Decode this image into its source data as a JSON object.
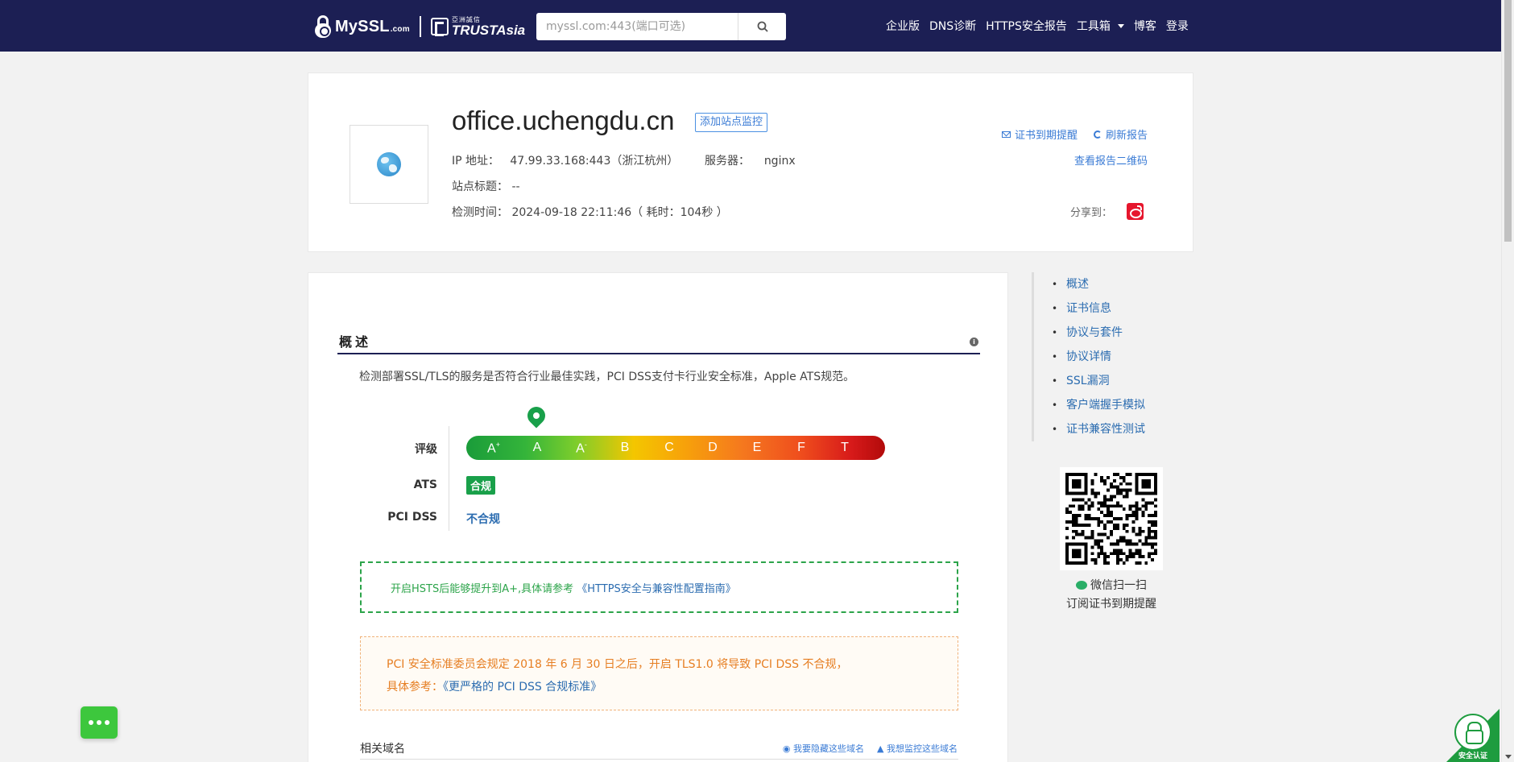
{
  "header": {
    "logo_text": "MySSL",
    "logo_suffix": ".com",
    "partner_cn": "亞洲誠信",
    "partner_en": "TRUSTAsia",
    "search_placeholder": "myssl.com:443(端口可选)",
    "nav": [
      "企业版",
      "DNS诊断",
      "HTTPS安全报告",
      "工具箱",
      "博客",
      "登录"
    ]
  },
  "site": {
    "domain": "office.uchengdu.cn",
    "monitor_button": "添加站点监控",
    "ip_label": "IP 地址：",
    "ip_value": "47.99.33.168:443（浙江杭州）",
    "server_label": "服务器：",
    "server_value": "nginx",
    "title_label": "站点标题：",
    "title_value": "--",
    "time_label": "检测时间：",
    "time_value": "2024-09-18 22:11:46（ 耗时：104秒 ）",
    "cert_reminder": "证书到期提醒",
    "refresh": "刷新报告",
    "qr_link": "查看报告二维码",
    "share_label": "分享到："
  },
  "overview": {
    "title": "概述",
    "description": "检测部署SSL/TLS的服务是否符合行业最佳实践，PCI DSS支付卡行业安全标准，Apple ATS规范。",
    "grade_label": "评级",
    "grades": [
      "A+",
      "A",
      "A-",
      "B",
      "C",
      "D",
      "E",
      "F",
      "T"
    ],
    "current_grade": "A",
    "ats_label": "ATS",
    "ats_value": "合规",
    "pci_label": "PCI DSS",
    "pci_value": "不合规",
    "hsts_notice": "开启HSTS后能够提升到A+,具体请参考",
    "hsts_link": "《HTTPS安全与兼容性配置指南》",
    "pci_notice_line1": "PCI 安全标准委员会规定 2018 年 6 月 30 日之后，开启 TLS1.0 将导致 PCI DSS 不合规，",
    "pci_notice_prefix": "具体参考：",
    "pci_notice_link": "《更严格的 PCI DSS 合规标准》",
    "related_label": "相关域名",
    "hide_link": "我要隐藏这些域名",
    "monitor_link": "我想监控这些域名"
  },
  "sidebar": {
    "items": [
      "概述",
      "证书信息",
      "协议与套件",
      "协议详情",
      "SSL漏洞",
      "客户端握手模拟",
      "证书兼容性测试"
    ],
    "qr_caption_1": "微信扫一扫",
    "qr_caption_2": "订阅证书到期提醒"
  },
  "badge": {
    "text": "安全认证"
  },
  "colors": {
    "header_bg": "#1c1f54",
    "accent_green": "#19a04a",
    "link_blue": "#2b6cb0",
    "warning_orange": "#e67e22"
  }
}
